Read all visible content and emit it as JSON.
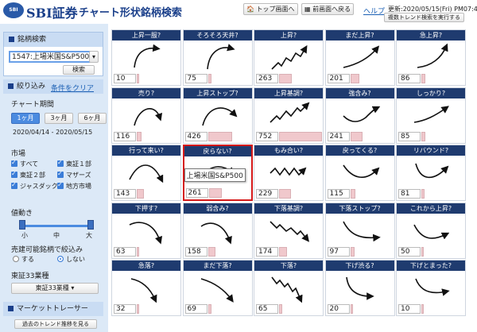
{
  "header": {
    "logo_text": "SBI",
    "brand": "SBI証券",
    "title": "チャート形状銘柄検索",
    "top_btn": "トップ画面へ",
    "back_btn": "前画面へ戻る",
    "help": "ヘルプ",
    "updated": "更新:2020/05/15(Fri) PM07:40",
    "multi_btn": "複数トレンド検索を実行する"
  },
  "search": {
    "heading": "銘柄検索",
    "selected": "1547:上場米国S&P500",
    "button": "検索"
  },
  "filter": {
    "heading": "絞り込み",
    "clear": "条件をクリア",
    "period_label": "チャート期間",
    "periods": [
      "1ヶ月",
      "3ヶ月",
      "6ヶ月"
    ],
    "active_period": 0,
    "date_range": "2020/04/14 - 2020/05/15",
    "market_label": "市場",
    "markets": [
      "すべて",
      "東証１部",
      "東証２部",
      "マザーズ",
      "ジャスダック",
      "地方市場"
    ],
    "price_label": "値動き",
    "slider_labels": [
      "小",
      "中",
      "大"
    ],
    "credit_label": "売建可能銘柄で絞込み",
    "credit_options": [
      "する",
      "しない"
    ],
    "credit_selected": 1,
    "sector_label": "東証33業種",
    "sector_value": "東証33業種"
  },
  "tracer": {
    "heading": "マーケットトレーサー",
    "button": "過去のトレンド推移を見る"
  },
  "tooltip": "上場米国S&P500",
  "cells": [
    {
      "label": "上昇一服?",
      "count": "10",
      "icon": "rise-plateau-icon",
      "bar": 0.03
    },
    {
      "label": "そろそろ天井?",
      "count": "75",
      "icon": "near-top-icon",
      "bar": 0.08
    },
    {
      "label": "上昇?",
      "count": "263",
      "icon": "zigzag-up-icon",
      "bar": 0.3
    },
    {
      "label": "まだ上昇?",
      "count": "201",
      "icon": "still-rising-icon",
      "bar": 0.2
    },
    {
      "label": "急上昇?",
      "count": "86",
      "icon": "sharp-rise-icon",
      "bar": 0.09
    },
    {
      "label": "売り?",
      "count": "116",
      "icon": "sell-icon",
      "bar": 0.12
    },
    {
      "label": "上昇ストップ?",
      "count": "426",
      "icon": "rise-stop-icon",
      "bar": 0.55
    },
    {
      "label": "上昇基調?",
      "count": "752",
      "icon": "uptrend-icon",
      "bar": 1.0
    },
    {
      "label": "強含み?",
      "count": "241",
      "icon": "firm-icon",
      "bar": 0.28
    },
    {
      "label": "しっかり?",
      "count": "85",
      "icon": "steady-icon",
      "bar": 0.09
    },
    {
      "label": "行って来い?",
      "count": "143",
      "icon": "round-trip-icon",
      "bar": 0.16
    },
    {
      "label": "戻らない?",
      "count": "261",
      "icon": "no-return-icon",
      "bar": 0.3
    },
    {
      "label": "もみ合い?",
      "count": "229",
      "icon": "range-icon",
      "bar": 0.27
    },
    {
      "label": "戻ってくる?",
      "count": "115",
      "icon": "coming-back-icon",
      "bar": 0.12
    },
    {
      "label": "リバウンド?",
      "count": "81",
      "icon": "rebound-icon",
      "bar": 0.08
    },
    {
      "label": "下押す?",
      "count": "63",
      "icon": "push-down-icon",
      "bar": 0.06
    },
    {
      "label": "弱含み?",
      "count": "158",
      "icon": "weak-icon",
      "bar": 0.17
    },
    {
      "label": "下落基調?",
      "count": "174",
      "icon": "downtrend-icon",
      "bar": 0.19
    },
    {
      "label": "下落ストップ?",
      "count": "97",
      "icon": "fall-stop-icon",
      "bar": 0.1
    },
    {
      "label": "これから上昇?",
      "count": "50",
      "icon": "about-to-rise-icon",
      "bar": 0.05
    },
    {
      "label": "急落?",
      "count": "32",
      "icon": "sharp-fall-icon",
      "bar": 0.03
    },
    {
      "label": "まだ下落?",
      "count": "69",
      "icon": "still-falling-icon",
      "bar": 0.07
    },
    {
      "label": "下落?",
      "count": "65",
      "icon": "zigzag-down-icon",
      "bar": 0.07
    },
    {
      "label": "下げ渋る?",
      "count": "20",
      "icon": "bottoming-icon",
      "bar": 0.02
    },
    {
      "label": "下げとまった?",
      "count": "10",
      "icon": "fall-stopped-icon",
      "bar": 0.01
    }
  ],
  "colors": {
    "cell_header": "#1f3b6f",
    "panel_bg": "#dce9f7",
    "bar": "#f0c8cc",
    "highlight": "#d51a1a",
    "active": "#4b8be0"
  }
}
